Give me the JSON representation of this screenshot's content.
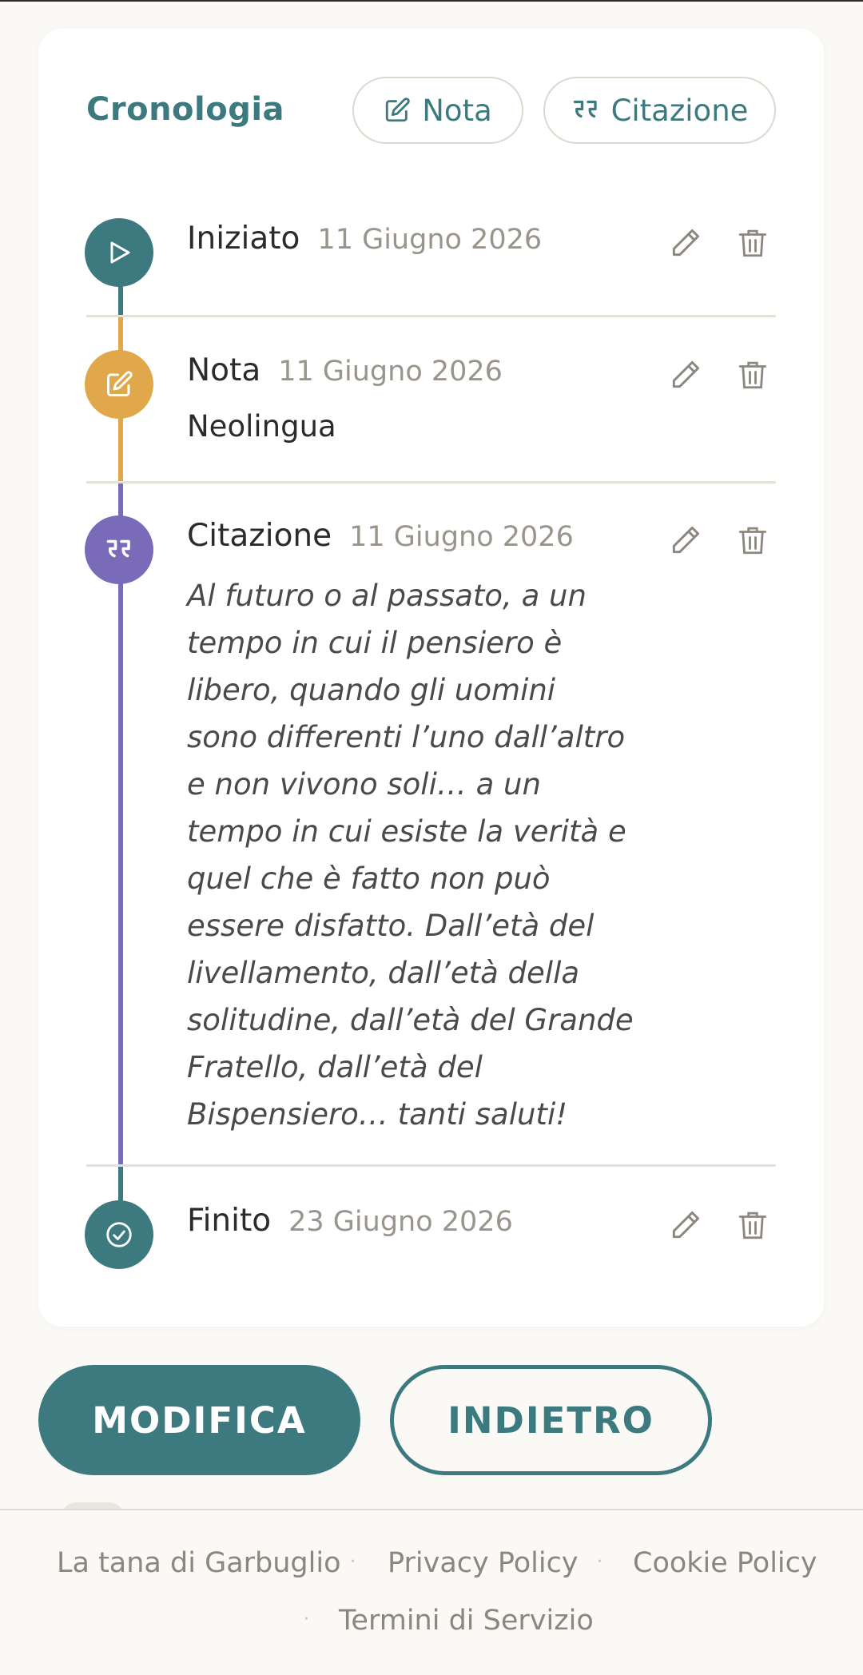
{
  "timeline": {
    "title": "Cronologia",
    "add_note_label": "Nota",
    "add_quote_label": "Citazione",
    "entries": [
      {
        "type": "Iniziato",
        "date": "11 Giugno 2026",
        "color": "#3c7a80"
      },
      {
        "type": "Nota",
        "date": "11 Giugno 2026",
        "text": "Neolingua",
        "color": "#e0a84a"
      },
      {
        "type": "Citazione",
        "date": "11 Giugno 2026",
        "text": "Al futuro o al passato, a un tempo in cui il pensiero è libero, quando gli uomini sono differenti l’uno dall’altro e non vivono soli… a un tempo in cui esiste la verità e quel che è fatto non può essere disfatto. Dall’età del livellamento, dall’età della solitudine, dall’età del Grande Fratello, dall’età del Bispensiero… tanti saluti!",
        "color": "#7a6bb8"
      },
      {
        "type": "Finito",
        "date": "23 Giugno 2026",
        "color": "#3c7a80"
      }
    ]
  },
  "actions": {
    "edit_label": "MODIFICA",
    "back_label": "INDIETRO"
  },
  "footer": {
    "links": [
      "La tana di Garbuglio",
      "Privacy Policy",
      "Cookie Policy",
      "Termini di Servizio"
    ],
    "separator": "·"
  },
  "colors": {
    "accent": "#3c7a80",
    "note": "#e0a84a",
    "quote": "#7a6bb8"
  }
}
